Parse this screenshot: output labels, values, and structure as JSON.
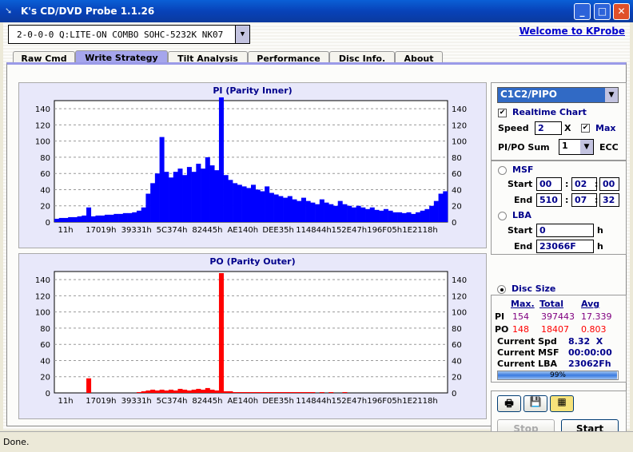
{
  "window": {
    "title": "K's CD/DVD Probe 1.1.26",
    "min": "_",
    "max": "□",
    "close": "✕"
  },
  "drive": {
    "selected": "2-0-0-0 Q:LITE-ON COMBO SOHC-5232K NK07"
  },
  "welcome_link": "Welcome to KProbe",
  "tabs": [
    {
      "label": "Raw Cmd"
    },
    {
      "label": "Write Strategy"
    },
    {
      "label": "Tilt Analysis"
    },
    {
      "label": "Performance"
    },
    {
      "label": "Disc Info."
    },
    {
      "label": "About"
    }
  ],
  "active_tab": "Write Strategy",
  "controls": {
    "mode": "C1C2/PIPO",
    "realtime_chart": "Realtime Chart",
    "realtime_checked": true,
    "speed_label": "Speed",
    "speed": "2",
    "speed_unit": "X",
    "max_label": "Max",
    "max_checked": true,
    "sum_label": "PI/PO Sum",
    "sum": "1",
    "ecc_label": "ECC",
    "msf_label": "MSF",
    "start_label": "Start",
    "end_label": "End",
    "msf_start": [
      "00",
      "02",
      "00"
    ],
    "msf_end": [
      "510",
      "07",
      "32"
    ],
    "colon": ":",
    "lba_label": "LBA",
    "lba_start": "0",
    "lba_end": "23066F",
    "h": "h",
    "disc_size_label": "Disc Size",
    "range_mode": "Disc Size"
  },
  "stats": {
    "headers": [
      "Max.",
      "Total",
      "Avg"
    ],
    "pi": {
      "label": "PI",
      "max": "154",
      "total": "397443",
      "avg": "17.339"
    },
    "po": {
      "label": "PO",
      "max": "148",
      "total": "18407",
      "avg": "0.803"
    },
    "current_spd_label": "Current Spd",
    "current_spd": "8.32  X",
    "current_msf_label": "Current MSF",
    "current_msf": "00:00:00",
    "current_lba_label": "Current LBA",
    "current_lba": "23062Fh",
    "progress": 99,
    "progress_text": "99%"
  },
  "buttons": {
    "print_icon": "printer-icon",
    "save_icon": "floppy-icon",
    "open_icon": "folder-chart-icon",
    "stop": "Stop",
    "start": "Start"
  },
  "status": "Done.",
  "chart_data": [
    {
      "type": "bar",
      "title": "PI (Parity Inner)",
      "color": "#0000ff",
      "ylim": [
        0,
        150
      ],
      "yticks": [
        0,
        20,
        40,
        60,
        80,
        100,
        120,
        140
      ],
      "xticks": [
        "11h",
        "17019h",
        "39331h",
        "5C374h",
        "82445h",
        "AE140h",
        "DEE35h",
        "114844h",
        "152E47h",
        "196F05h",
        "1E2118h"
      ],
      "grid": true,
      "values": [
        4,
        5,
        5,
        6,
        6,
        7,
        8,
        18,
        7,
        8,
        8,
        9,
        9,
        10,
        10,
        11,
        11,
        12,
        14,
        18,
        35,
        48,
        60,
        105,
        62,
        55,
        62,
        66,
        58,
        68,
        62,
        72,
        66,
        80,
        70,
        64,
        154,
        58,
        52,
        48,
        46,
        44,
        42,
        46,
        40,
        38,
        44,
        36,
        34,
        32,
        30,
        32,
        28,
        26,
        30,
        26,
        24,
        22,
        28,
        24,
        22,
        20,
        26,
        22,
        20,
        18,
        20,
        18,
        16,
        18,
        15,
        14,
        16,
        14,
        12,
        12,
        11,
        12,
        10,
        12,
        14,
        16,
        20,
        26,
        35,
        38
      ]
    },
    {
      "type": "bar",
      "title": "PO (Parity Outer)",
      "color": "#ff0000",
      "ylim": [
        0,
        150
      ],
      "yticks": [
        0,
        20,
        40,
        60,
        80,
        100,
        120,
        140
      ],
      "xticks": [
        "11h",
        "17019h",
        "39331h",
        "5C374h",
        "82445h",
        "AE140h",
        "DEE35h",
        "114844h",
        "152E47h",
        "196F05h",
        "1E2118h"
      ],
      "grid": true,
      "values": [
        0,
        0,
        0,
        0,
        0,
        0,
        0,
        18,
        0,
        0,
        0,
        0,
        0,
        0,
        0,
        0,
        0,
        0,
        1,
        2,
        3,
        4,
        3,
        4,
        3,
        4,
        3,
        5,
        4,
        3,
        4,
        5,
        4,
        6,
        4,
        3,
        148,
        2,
        2,
        1,
        1,
        1,
        1,
        1,
        1,
        1,
        1,
        1,
        1,
        1,
        1,
        1,
        1,
        1,
        1,
        1,
        1,
        0,
        1,
        0,
        1,
        0,
        0,
        1,
        0,
        0,
        0,
        0,
        0,
        0,
        0,
        0,
        0,
        0,
        0,
        0,
        0,
        0,
        0,
        0,
        0,
        0,
        0,
        0,
        0,
        0
      ]
    }
  ]
}
